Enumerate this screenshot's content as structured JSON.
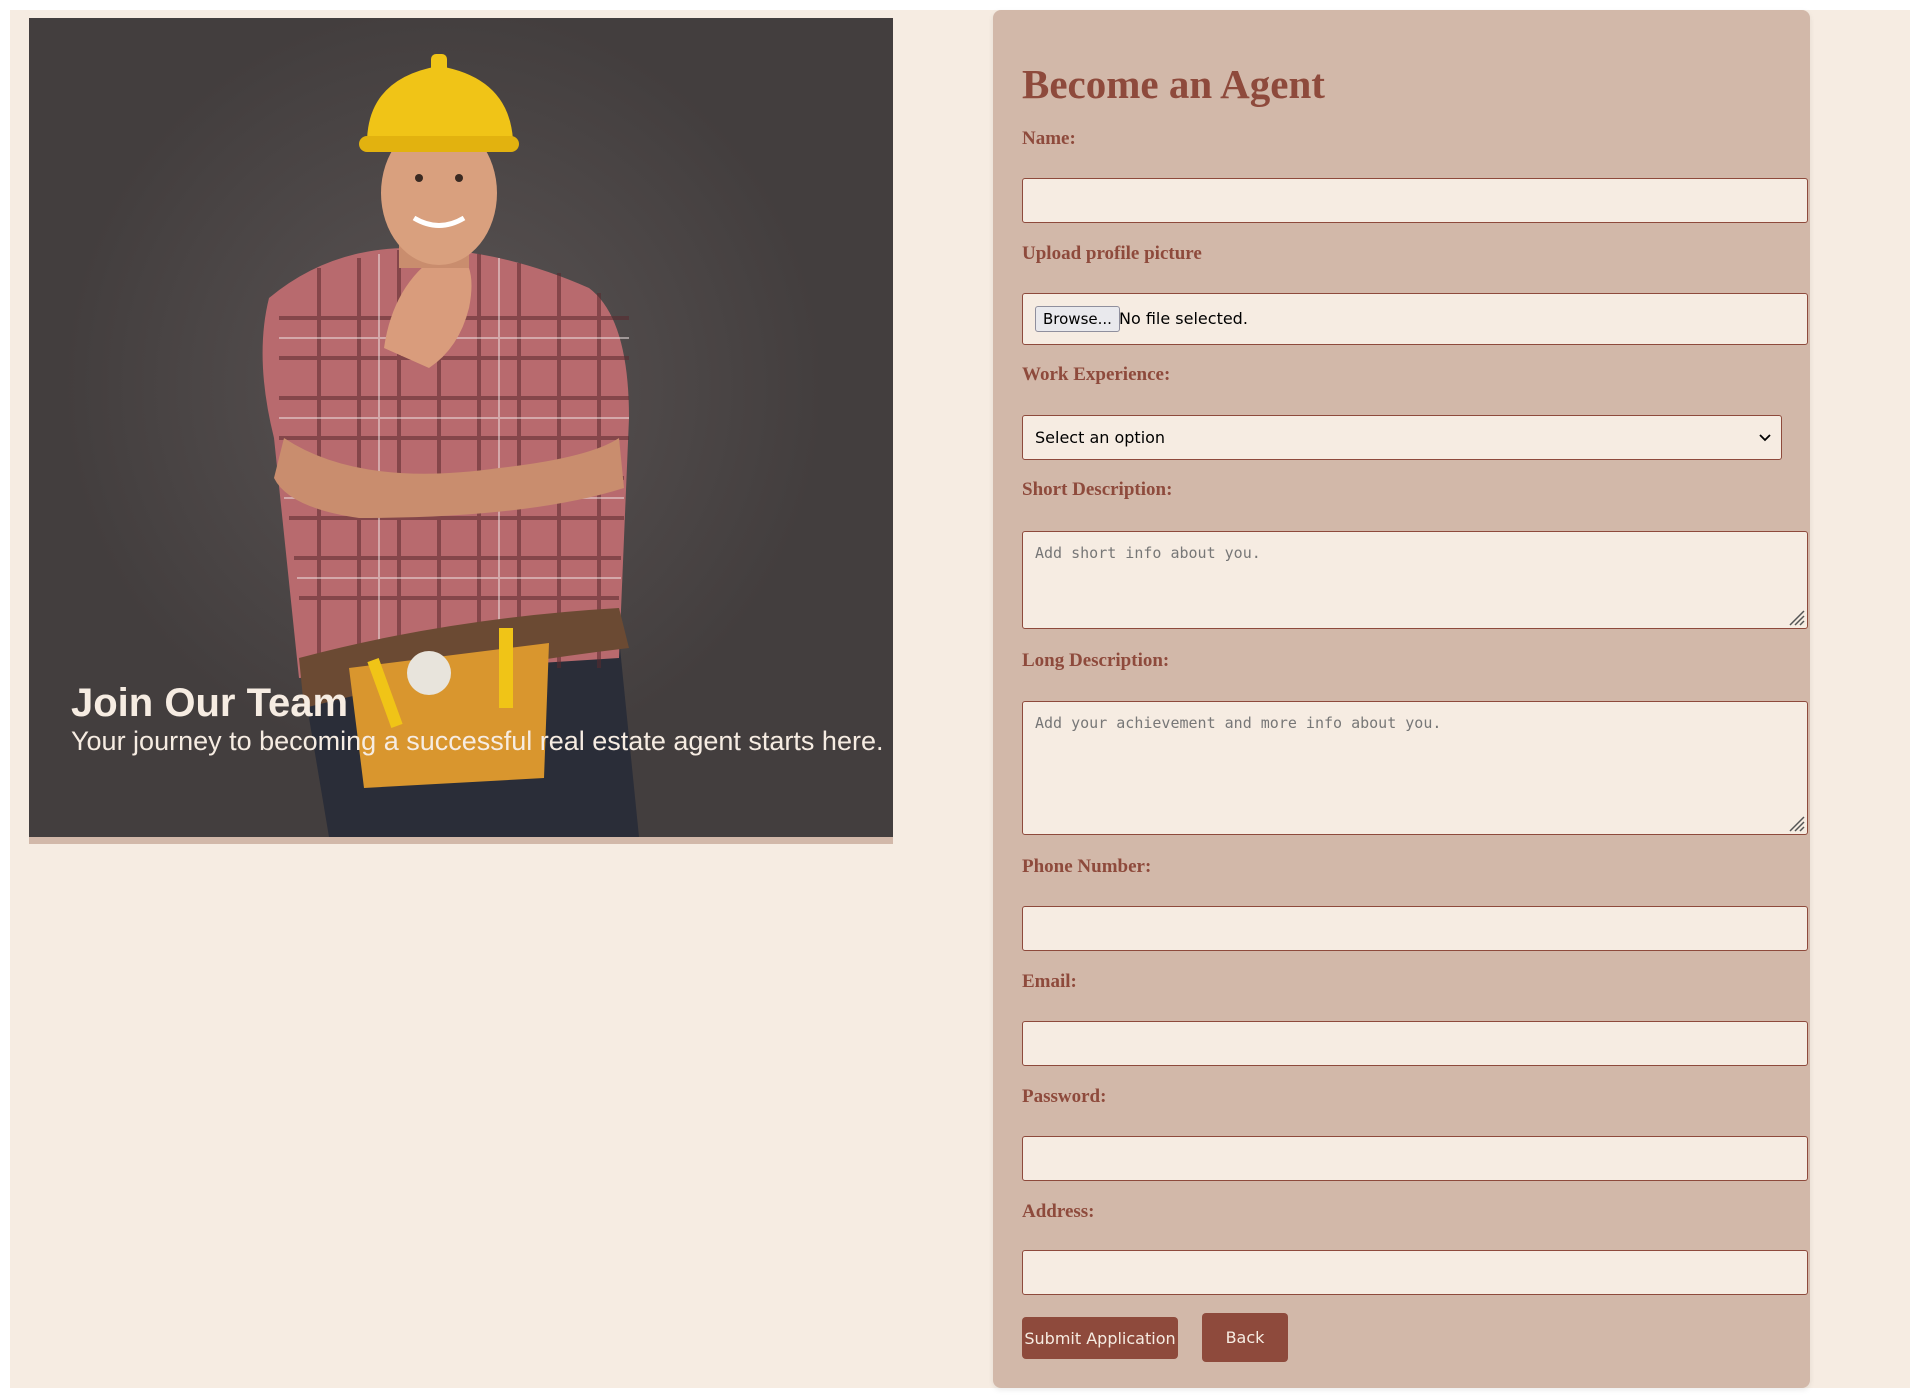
{
  "hero": {
    "title": "Join Our Team",
    "subtitle": "Your journey to becoming a successful real estate agent starts here."
  },
  "form": {
    "title": "Become an Agent",
    "name": {
      "label": "Name:",
      "value": ""
    },
    "profile_picture": {
      "label": "Upload profile picture",
      "browse_label": "Browse...",
      "status": "No file selected."
    },
    "work_experience": {
      "label": "Work Experience:",
      "selected": "Select an option"
    },
    "short_description": {
      "label": "Short Description:",
      "placeholder": "Add short info about you."
    },
    "long_description": {
      "label": "Long Description:",
      "placeholder": "Add your achievement and more info about you."
    },
    "phone": {
      "label": "Phone Number:",
      "value": ""
    },
    "email": {
      "label": "Email:",
      "value": ""
    },
    "password": {
      "label": "Password:",
      "value": ""
    },
    "address": {
      "label": "Address:",
      "value": ""
    },
    "submit_label": "Submit Application",
    "back_label": "Back"
  },
  "colors": {
    "accent": "#8e4a3c",
    "card": "#d2b8a9",
    "background": "#f6ece2",
    "hero_bg": "#433e3e"
  }
}
